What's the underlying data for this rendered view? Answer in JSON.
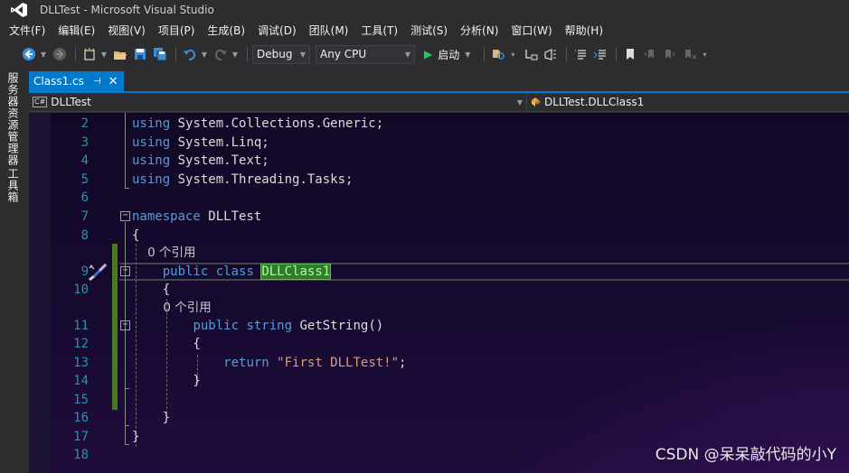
{
  "window": {
    "title": "DLLTest - Microsoft Visual Studio"
  },
  "menu": [
    "文件(F)",
    "编辑(E)",
    "视图(V)",
    "项目(P)",
    "生成(B)",
    "调试(D)",
    "团队(M)",
    "工具(T)",
    "测试(S)",
    "分析(N)",
    "窗口(W)",
    "帮助(H)"
  ],
  "toolbar": {
    "configuration": "Debug",
    "platform": "Any CPU",
    "start_label": "启动"
  },
  "side_tabs": [
    "服务器资源管理器",
    "工具箱"
  ],
  "document_tab": {
    "label": "Class1.cs",
    "pin": "⊣",
    "close": "✕"
  },
  "navbar": {
    "project": "DLLTest",
    "member": "DLLTest.DLLClass1",
    "cs_badge": "C#"
  },
  "editor": {
    "lines": [
      {
        "n": "2",
        "parts": [
          [
            "kw",
            "using"
          ],
          [
            "plain",
            " System.Collections.Generic;"
          ]
        ]
      },
      {
        "n": "3",
        "parts": [
          [
            "kw",
            "using"
          ],
          [
            "plain",
            " System.Linq;"
          ]
        ]
      },
      {
        "n": "4",
        "parts": [
          [
            "kw",
            "using"
          ],
          [
            "plain",
            " System.Text;"
          ]
        ]
      },
      {
        "n": "5",
        "parts": [
          [
            "kw",
            "using"
          ],
          [
            "plain",
            " System.Threading.Tasks;"
          ]
        ]
      },
      {
        "n": "6",
        "parts": []
      },
      {
        "n": "7",
        "parts": [
          [
            "kw",
            "namespace"
          ],
          [
            "plain",
            " DLLTest"
          ]
        ]
      },
      {
        "n": "8",
        "parts": [
          [
            "plain",
            "{"
          ]
        ]
      },
      {
        "n": "",
        "parts": [
          [
            "ref",
            "    0 个引用"
          ]
        ]
      },
      {
        "n": "9",
        "parts": [
          [
            "plain",
            "    "
          ],
          [
            "kw",
            "public"
          ],
          [
            "plain",
            " "
          ],
          [
            "kw",
            "class"
          ],
          [
            "plain",
            " "
          ],
          [
            "hl",
            "DLLClass1"
          ]
        ]
      },
      {
        "n": "10",
        "parts": [
          [
            "plain",
            "    {"
          ]
        ]
      },
      {
        "n": "",
        "parts": [
          [
            "ref",
            "        0 个引用"
          ]
        ]
      },
      {
        "n": "11",
        "parts": [
          [
            "plain",
            "        "
          ],
          [
            "kw",
            "public"
          ],
          [
            "plain",
            " "
          ],
          [
            "kw",
            "string"
          ],
          [
            "plain",
            " GetString()"
          ]
        ]
      },
      {
        "n": "12",
        "parts": [
          [
            "plain",
            "        {"
          ]
        ]
      },
      {
        "n": "13",
        "parts": [
          [
            "plain",
            "            "
          ],
          [
            "kw",
            "return"
          ],
          [
            "plain",
            " "
          ],
          [
            "str",
            "\"First DLLTest!\""
          ],
          [
            "plain",
            ";"
          ]
        ]
      },
      {
        "n": "14",
        "parts": [
          [
            "plain",
            "        }"
          ]
        ]
      },
      {
        "n": "15",
        "parts": []
      },
      {
        "n": "16",
        "parts": [
          [
            "plain",
            "    }"
          ]
        ]
      },
      {
        "n": "17",
        "parts": [
          [
            "plain",
            "}"
          ]
        ]
      },
      {
        "n": "18",
        "parts": []
      }
    ]
  },
  "watermark": "CSDN @呆呆敲代码的小Y",
  "colors": {
    "accent": "#007acc",
    "keyword": "#569cd6",
    "line_number": "#2b91af",
    "string": "#d69d85",
    "change_bar": "#4a7a1f"
  }
}
